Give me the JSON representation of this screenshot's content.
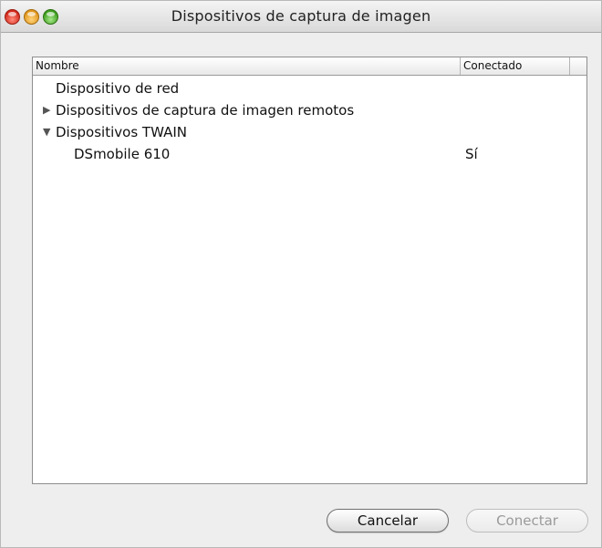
{
  "window": {
    "title": "Dispositivos de captura de imagen"
  },
  "table": {
    "headers": {
      "name": "Nombre",
      "connected": "Conectado"
    },
    "rows": [
      {
        "label": "Dispositivo de red",
        "connected": "",
        "expander": ""
      },
      {
        "label": "Dispositivos de captura de imagen remotos",
        "connected": "",
        "expander": "▶"
      },
      {
        "label": "Dispositivos TWAIN",
        "connected": "",
        "expander": "▼"
      },
      {
        "label": "DSmobile 610",
        "connected": "Sí",
        "expander": ""
      }
    ]
  },
  "buttons": {
    "cancel": "Cancelar",
    "connect": "Conectar"
  }
}
